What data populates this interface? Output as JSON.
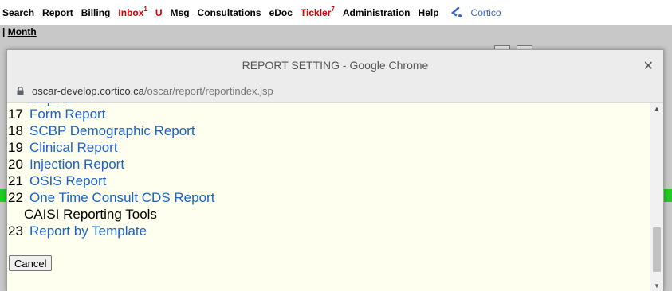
{
  "background": {
    "nav": [
      {
        "label": "Search",
        "accel": "S",
        "rest": "earch",
        "color": "black"
      },
      {
        "label": "Report",
        "accel": "R",
        "rest": "eport",
        "color": "black"
      },
      {
        "label": "Billing",
        "accel": "B",
        "rest": "illing",
        "color": "black"
      },
      {
        "label": "Inbox",
        "accel": "I",
        "rest": "nbox",
        "color": "red",
        "badge": "1"
      },
      {
        "label": "U",
        "accel": "U",
        "rest": "",
        "color": "red"
      },
      {
        "label": "Msg",
        "accel": "M",
        "rest": "sg",
        "color": "black"
      },
      {
        "label": "Consultations",
        "accel": "C",
        "rest": "onsultations",
        "color": "black"
      },
      {
        "label": "eDoc",
        "accel": "",
        "rest": "eDoc",
        "color": "black"
      },
      {
        "label": "Tickler",
        "accel": "T",
        "rest": "ickler",
        "color": "red",
        "badge": "7"
      },
      {
        "label": "Administration",
        "accel": "",
        "rest": "Administration",
        "color": "black"
      },
      {
        "label": "Help",
        "accel": "H",
        "rest": "elp",
        "color": "black"
      }
    ],
    "cortico_label": "Cortico",
    "month_label": "Month",
    "icons": [
      "cortico-logo-icon"
    ]
  },
  "popup": {
    "title": "REPORT SETTING - Google Chrome",
    "close_glyph": "✕",
    "url_host": "oscar-develop.cortico.ca",
    "url_path": "/oscar/report/reportindex.jsp",
    "rows": [
      {
        "type": "report",
        "num": "17",
        "label": "Form Report"
      },
      {
        "type": "report",
        "num": "18",
        "label": "SCBP Demographic Report"
      },
      {
        "type": "report",
        "num": "19",
        "label": "Clinical Report"
      },
      {
        "type": "report",
        "num": "20",
        "label": "Injection Report"
      },
      {
        "type": "report",
        "num": "21",
        "label": "OSIS Report"
      },
      {
        "type": "report",
        "num": "22",
        "label": "One Time Consult CDS Report"
      },
      {
        "type": "section",
        "label": "CAISI Reporting Tools"
      },
      {
        "type": "report",
        "num": "23",
        "label": "Report by Template"
      }
    ],
    "cancel_label": "Cancel",
    "colors": {
      "link": "#1a63c9",
      "content_bg": "#fffff0",
      "alert_red": "#cc0000",
      "green_strip": "#22cc22"
    }
  }
}
